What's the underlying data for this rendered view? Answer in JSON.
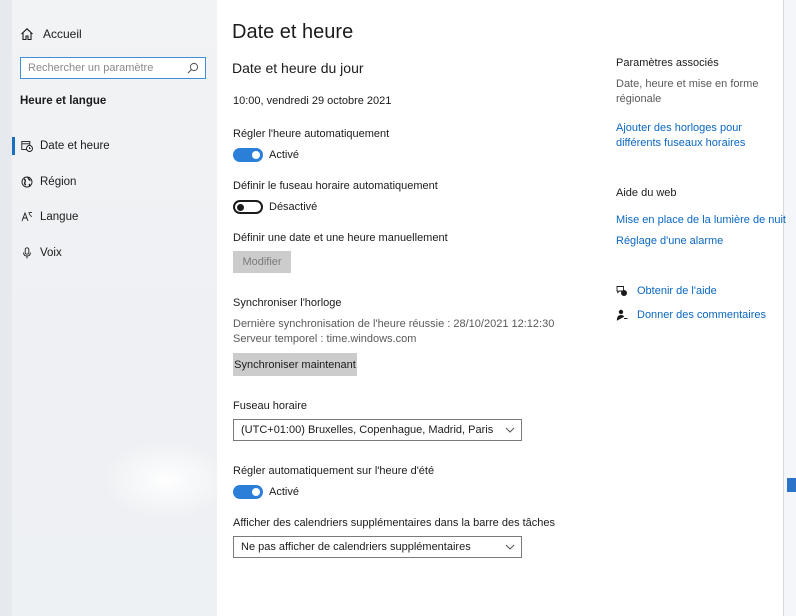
{
  "sidebar": {
    "home_label": "Accueil",
    "search_placeholder": "Rechercher un paramètre",
    "section_title": "Heure et langue",
    "items": [
      {
        "label": "Date et heure",
        "icon": "calendar-clock-icon",
        "selected": true
      },
      {
        "label": "Région",
        "icon": "globe-icon",
        "selected": false
      },
      {
        "label": "Langue",
        "icon": "language-icon",
        "selected": false
      },
      {
        "label": "Voix",
        "icon": "microphone-icon",
        "selected": false
      }
    ]
  },
  "main": {
    "page_title": "Date et heure",
    "section_title": "Date et heure du jour",
    "current_datetime": "10:00, vendredi 29 octobre 2021",
    "auto_time": {
      "label": "Régler l'heure automatiquement",
      "state": "on",
      "state_label": "Activé"
    },
    "auto_timezone": {
      "label": "Définir le fuseau horaire automatiquement",
      "state": "off",
      "state_label": "Désactivé"
    },
    "manual": {
      "label": "Définir une date et une heure manuellement",
      "button": "Modifier"
    },
    "sync": {
      "title": "Synchroniser l'horloge",
      "last_sync": "Dernière synchronisation de l'heure réussie : 28/10/2021 12:12:30",
      "server": "Serveur temporel : time.windows.com",
      "button": "Synchroniser maintenant"
    },
    "timezone": {
      "label": "Fuseau horaire",
      "value": "(UTC+01:00) Bruxelles, Copenhague, Madrid, Paris"
    },
    "dst": {
      "label": "Régler automatiquement sur l'heure d'été",
      "state": "on",
      "state_label": "Activé"
    },
    "calendars": {
      "label": "Afficher des calendriers supplémentaires dans la barre des tâches",
      "value": "Ne pas afficher de calendriers supplémentaires"
    }
  },
  "related": {
    "title": "Paramètres associés",
    "desc_line1": "Date, heure et mise en forme",
    "desc_line2": "régionale",
    "link_line1": "Ajouter des horloges pour",
    "link_line2": "différents fuseaux horaires"
  },
  "web_help": {
    "title": "Aide du web",
    "links": [
      "Mise en place de la lumière de nuit",
      "Réglage d'une alarme"
    ]
  },
  "help": {
    "get_help": "Obtenir de l'aide",
    "feedback": "Donner des commentaires"
  },
  "colors": {
    "accent": "#2b7fd8",
    "link": "#0a67c1",
    "sidebar_bg": "#eef0f3"
  }
}
